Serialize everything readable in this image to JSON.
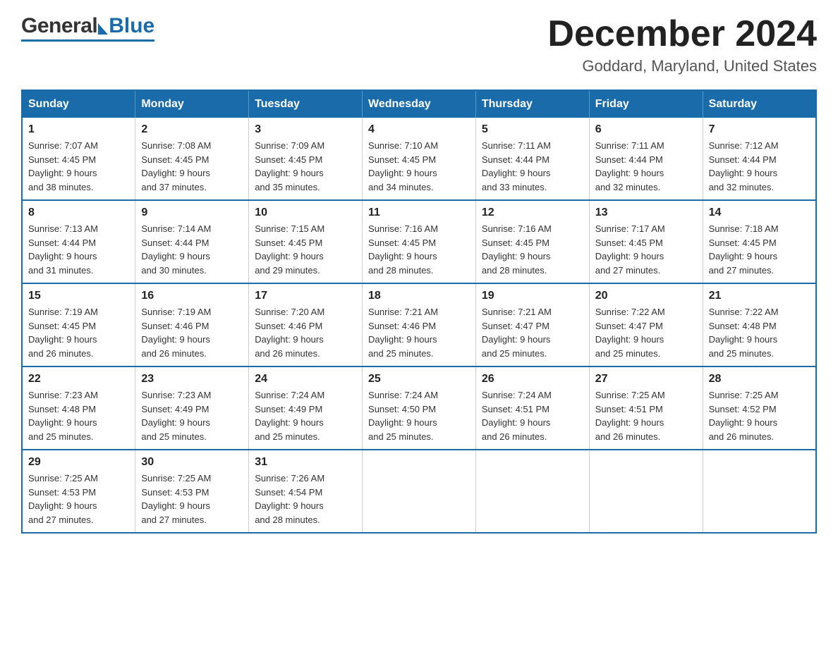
{
  "header": {
    "logo_general": "General",
    "logo_blue": "Blue",
    "month_title": "December 2024",
    "location": "Goddard, Maryland, United States"
  },
  "weekdays": [
    "Sunday",
    "Monday",
    "Tuesday",
    "Wednesday",
    "Thursday",
    "Friday",
    "Saturday"
  ],
  "weeks": [
    [
      {
        "day": "1",
        "sunrise": "7:07 AM",
        "sunset": "4:45 PM",
        "daylight": "9 hours and 38 minutes."
      },
      {
        "day": "2",
        "sunrise": "7:08 AM",
        "sunset": "4:45 PM",
        "daylight": "9 hours and 37 minutes."
      },
      {
        "day": "3",
        "sunrise": "7:09 AM",
        "sunset": "4:45 PM",
        "daylight": "9 hours and 35 minutes."
      },
      {
        "day": "4",
        "sunrise": "7:10 AM",
        "sunset": "4:45 PM",
        "daylight": "9 hours and 34 minutes."
      },
      {
        "day": "5",
        "sunrise": "7:11 AM",
        "sunset": "4:44 PM",
        "daylight": "9 hours and 33 minutes."
      },
      {
        "day": "6",
        "sunrise": "7:11 AM",
        "sunset": "4:44 PM",
        "daylight": "9 hours and 32 minutes."
      },
      {
        "day": "7",
        "sunrise": "7:12 AM",
        "sunset": "4:44 PM",
        "daylight": "9 hours and 32 minutes."
      }
    ],
    [
      {
        "day": "8",
        "sunrise": "7:13 AM",
        "sunset": "4:44 PM",
        "daylight": "9 hours and 31 minutes."
      },
      {
        "day": "9",
        "sunrise": "7:14 AM",
        "sunset": "4:44 PM",
        "daylight": "9 hours and 30 minutes."
      },
      {
        "day": "10",
        "sunrise": "7:15 AM",
        "sunset": "4:45 PM",
        "daylight": "9 hours and 29 minutes."
      },
      {
        "day": "11",
        "sunrise": "7:16 AM",
        "sunset": "4:45 PM",
        "daylight": "9 hours and 28 minutes."
      },
      {
        "day": "12",
        "sunrise": "7:16 AM",
        "sunset": "4:45 PM",
        "daylight": "9 hours and 28 minutes."
      },
      {
        "day": "13",
        "sunrise": "7:17 AM",
        "sunset": "4:45 PM",
        "daylight": "9 hours and 27 minutes."
      },
      {
        "day": "14",
        "sunrise": "7:18 AM",
        "sunset": "4:45 PM",
        "daylight": "9 hours and 27 minutes."
      }
    ],
    [
      {
        "day": "15",
        "sunrise": "7:19 AM",
        "sunset": "4:45 PM",
        "daylight": "9 hours and 26 minutes."
      },
      {
        "day": "16",
        "sunrise": "7:19 AM",
        "sunset": "4:46 PM",
        "daylight": "9 hours and 26 minutes."
      },
      {
        "day": "17",
        "sunrise": "7:20 AM",
        "sunset": "4:46 PM",
        "daylight": "9 hours and 26 minutes."
      },
      {
        "day": "18",
        "sunrise": "7:21 AM",
        "sunset": "4:46 PM",
        "daylight": "9 hours and 25 minutes."
      },
      {
        "day": "19",
        "sunrise": "7:21 AM",
        "sunset": "4:47 PM",
        "daylight": "9 hours and 25 minutes."
      },
      {
        "day": "20",
        "sunrise": "7:22 AM",
        "sunset": "4:47 PM",
        "daylight": "9 hours and 25 minutes."
      },
      {
        "day": "21",
        "sunrise": "7:22 AM",
        "sunset": "4:48 PM",
        "daylight": "9 hours and 25 minutes."
      }
    ],
    [
      {
        "day": "22",
        "sunrise": "7:23 AM",
        "sunset": "4:48 PM",
        "daylight": "9 hours and 25 minutes."
      },
      {
        "day": "23",
        "sunrise": "7:23 AM",
        "sunset": "4:49 PM",
        "daylight": "9 hours and 25 minutes."
      },
      {
        "day": "24",
        "sunrise": "7:24 AM",
        "sunset": "4:49 PM",
        "daylight": "9 hours and 25 minutes."
      },
      {
        "day": "25",
        "sunrise": "7:24 AM",
        "sunset": "4:50 PM",
        "daylight": "9 hours and 25 minutes."
      },
      {
        "day": "26",
        "sunrise": "7:24 AM",
        "sunset": "4:51 PM",
        "daylight": "9 hours and 26 minutes."
      },
      {
        "day": "27",
        "sunrise": "7:25 AM",
        "sunset": "4:51 PM",
        "daylight": "9 hours and 26 minutes."
      },
      {
        "day": "28",
        "sunrise": "7:25 AM",
        "sunset": "4:52 PM",
        "daylight": "9 hours and 26 minutes."
      }
    ],
    [
      {
        "day": "29",
        "sunrise": "7:25 AM",
        "sunset": "4:53 PM",
        "daylight": "9 hours and 27 minutes."
      },
      {
        "day": "30",
        "sunrise": "7:25 AM",
        "sunset": "4:53 PM",
        "daylight": "9 hours and 27 minutes."
      },
      {
        "day": "31",
        "sunrise": "7:26 AM",
        "sunset": "4:54 PM",
        "daylight": "9 hours and 28 minutes."
      },
      null,
      null,
      null,
      null
    ]
  ],
  "labels": {
    "sunrise": "Sunrise:",
    "sunset": "Sunset:",
    "daylight": "Daylight:"
  },
  "colors": {
    "header_bg": "#1a6baa",
    "border": "#1a6baa"
  }
}
